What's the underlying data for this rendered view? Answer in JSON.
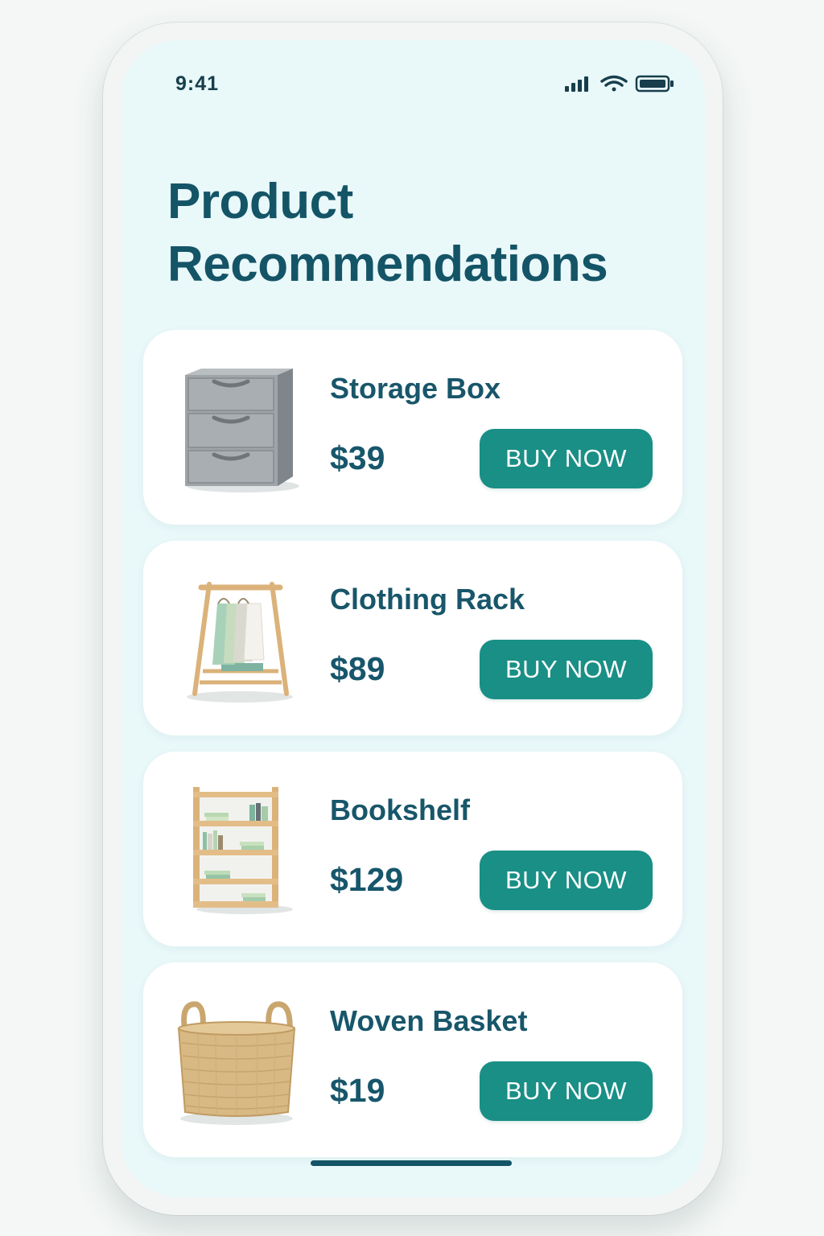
{
  "status_bar": {
    "time": "9:41",
    "icons": [
      "signal-icon",
      "wifi-icon",
      "battery-icon"
    ]
  },
  "header": {
    "title": "Product Recommendations"
  },
  "products": [
    {
      "name": "Storage Box",
      "price": "$39",
      "button_label": "BUY NOW",
      "image_icon": "storage-drawers-icon"
    },
    {
      "name": "Clothing Rack",
      "price": "$89",
      "button_label": "BUY NOW",
      "image_icon": "clothing-rack-icon"
    },
    {
      "name": "Bookshelf",
      "price": "$129",
      "button_label": "BUY NOW",
      "image_icon": "bookshelf-icon"
    },
    {
      "name": "Woven Basket",
      "price": "$19",
      "button_label": "BUY NOW",
      "image_icon": "woven-basket-icon"
    }
  ],
  "colors": {
    "screen_background": "#e9f8f9",
    "heading": "#145467",
    "button": "#198f86",
    "card": "#ffffff"
  }
}
